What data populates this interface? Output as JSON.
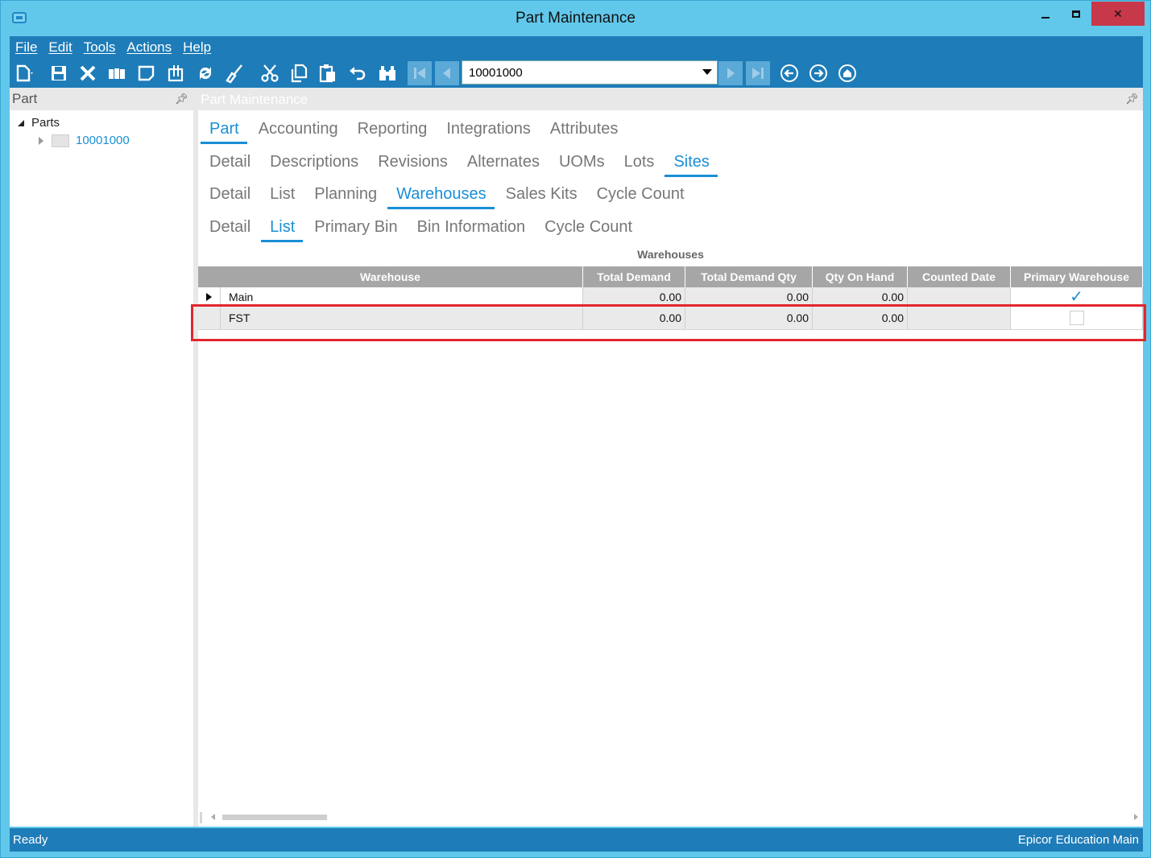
{
  "window": {
    "title": "Part Maintenance"
  },
  "menu": [
    {
      "label": "File"
    },
    {
      "label": "Edit"
    },
    {
      "label": "Tools"
    },
    {
      "label": "Actions"
    },
    {
      "label": "Help"
    }
  ],
  "toolbar": {
    "key_value": "10001000",
    "icons": [
      "new-icon",
      "save-icon",
      "delete-icon",
      "book-icon",
      "note-icon",
      "attachment-icon",
      "refresh-icon",
      "clear-icon",
      "cut-icon",
      "copy-icon",
      "paste-icon",
      "undo-icon",
      "search-icon"
    ]
  },
  "left_panel": {
    "title": "Part",
    "tree_root": "Parts",
    "tree_child": "10001000"
  },
  "main_panel": {
    "title": "Part Maintenance",
    "tabs_l1": [
      {
        "label": "Part",
        "active": true
      },
      {
        "label": "Accounting"
      },
      {
        "label": "Reporting"
      },
      {
        "label": "Integrations"
      },
      {
        "label": "Attributes"
      }
    ],
    "tabs_l2": [
      {
        "label": "Detail"
      },
      {
        "label": "Descriptions"
      },
      {
        "label": "Revisions"
      },
      {
        "label": "Alternates"
      },
      {
        "label": "UOMs"
      },
      {
        "label": "Lots"
      },
      {
        "label": "Sites",
        "active": true
      }
    ],
    "tabs_l3": [
      {
        "label": "Detail"
      },
      {
        "label": "List"
      },
      {
        "label": "Planning"
      },
      {
        "label": "Warehouses",
        "active": true
      },
      {
        "label": "Sales Kits"
      },
      {
        "label": "Cycle Count"
      }
    ],
    "tabs_l4": [
      {
        "label": "Detail"
      },
      {
        "label": "List",
        "active": true
      },
      {
        "label": "Primary Bin"
      },
      {
        "label": "Bin Information"
      },
      {
        "label": "Cycle Count"
      }
    ]
  },
  "grid": {
    "caption": "Warehouses",
    "columns": [
      "Warehouse",
      "Total Demand",
      "Total Demand Qty",
      "Qty On Hand",
      "Counted Date",
      "Primary Warehouse"
    ],
    "rows": [
      {
        "warehouse": "Main",
        "total_demand": "0.00",
        "total_demand_qty": "0.00",
        "qty_on_hand": "0.00",
        "counted_date": "",
        "primary": true,
        "current": true
      },
      {
        "warehouse": "FST",
        "total_demand": "0.00",
        "total_demand_qty": "0.00",
        "qty_on_hand": "0.00",
        "counted_date": "",
        "primary": false,
        "current": false
      }
    ]
  },
  "status": {
    "left": "Ready",
    "right": "Epicor Education  Main"
  },
  "colors": {
    "accent": "#1a8fd6",
    "chrome": "#1e7cb8",
    "frame": "#62c8eb",
    "highlight": "#e1262e"
  }
}
